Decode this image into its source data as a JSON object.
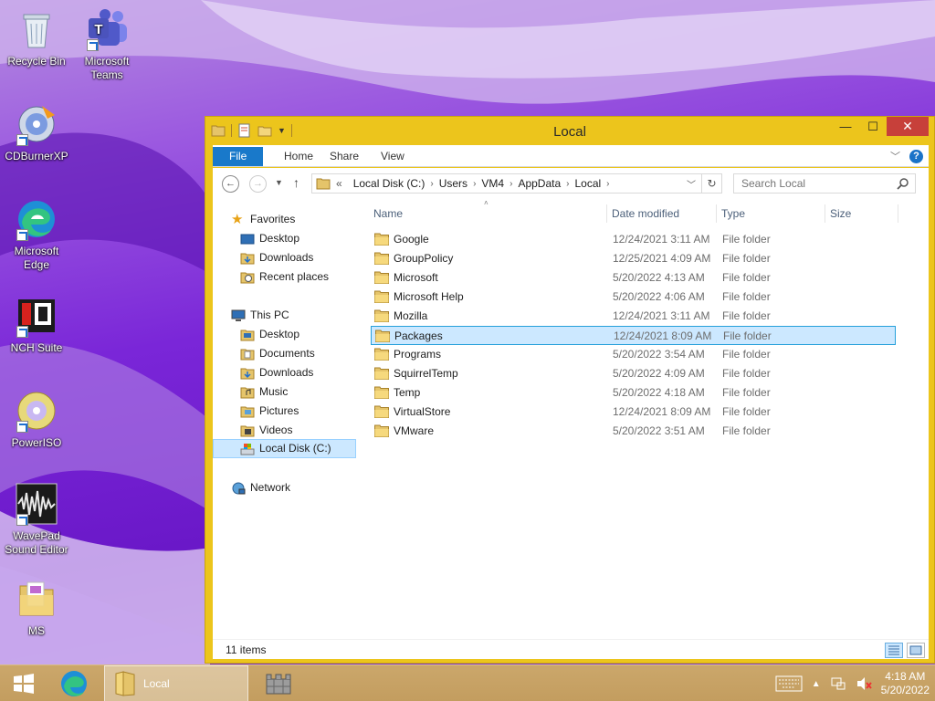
{
  "desktop": {
    "icons": [
      {
        "label": "Recycle Bin",
        "icon": "recycle-bin-icon"
      },
      {
        "label": "Microsoft Teams",
        "icon": "teams-icon"
      },
      {
        "label": "CDBurnerXP",
        "icon": "cdburner-icon"
      },
      {
        "label": "Microsoft Edge",
        "icon": "edge-icon"
      },
      {
        "label": "NCH Suite",
        "icon": "nch-icon"
      },
      {
        "label": "PowerISO",
        "icon": "poweriso-icon"
      },
      {
        "label": "WavePad Sound Editor",
        "icon": "wavepad-icon"
      },
      {
        "label": "MS",
        "icon": "folder-icon"
      }
    ]
  },
  "window": {
    "title": "Local",
    "ribbon_tabs": [
      "File",
      "Home",
      "Share",
      "View"
    ],
    "breadcrumb": [
      "Local Disk (C:)",
      "Users",
      "VM4",
      "AppData",
      "Local"
    ],
    "breadcrumb_prefix": "«",
    "search_placeholder": "Search Local",
    "nav": {
      "favorites_header": "Favorites",
      "favorites": [
        "Desktop",
        "Downloads",
        "Recent places"
      ],
      "thispc_header": "This PC",
      "thispc": [
        "Desktop",
        "Documents",
        "Downloads",
        "Music",
        "Pictures",
        "Videos",
        "Local Disk (C:)"
      ],
      "network": "Network"
    },
    "columns": [
      "Name",
      "Date modified",
      "Type",
      "Size"
    ],
    "files": [
      {
        "name": "Google",
        "date": "12/24/2021 3:11 AM",
        "type": "File folder"
      },
      {
        "name": "GroupPolicy",
        "date": "12/25/2021 4:09 AM",
        "type": "File folder"
      },
      {
        "name": "Microsoft",
        "date": "5/20/2022 4:13 AM",
        "type": "File folder"
      },
      {
        "name": "Microsoft Help",
        "date": "5/20/2022 4:06 AM",
        "type": "File folder"
      },
      {
        "name": "Mozilla",
        "date": "12/24/2021 3:11 AM",
        "type": "File folder"
      },
      {
        "name": "Packages",
        "date": "12/24/2021 8:09 AM",
        "type": "File folder"
      },
      {
        "name": "Programs",
        "date": "5/20/2022 3:54 AM",
        "type": "File folder"
      },
      {
        "name": "SquirrelTemp",
        "date": "5/20/2022 4:09 AM",
        "type": "File folder"
      },
      {
        "name": "Temp",
        "date": "5/20/2022 4:18 AM",
        "type": "File folder"
      },
      {
        "name": "VirtualStore",
        "date": "12/24/2021 8:09 AM",
        "type": "File folder"
      },
      {
        "name": "VMware",
        "date": "5/20/2022 3:51 AM",
        "type": "File folder"
      }
    ],
    "selected_file": "Packages",
    "status": "11 items",
    "colors": {
      "frame": "#ecc51c",
      "file_tab": "#1979ca",
      "selection": "#cce8ff",
      "close": "#c7403a"
    }
  },
  "taskbar": {
    "active_label": "Local",
    "time": "4:18 AM",
    "date": "5/20/2022"
  }
}
